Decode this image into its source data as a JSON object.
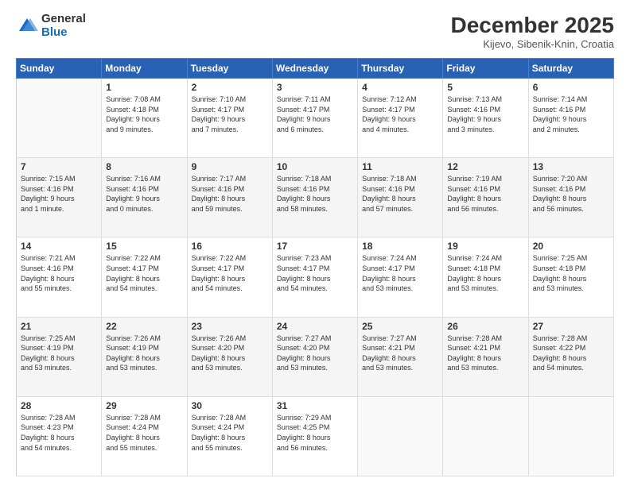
{
  "header": {
    "logo_general": "General",
    "logo_blue": "Blue",
    "month_title": "December 2025",
    "location": "Kijevo, Sibenik-Knin, Croatia"
  },
  "days_of_week": [
    "Sunday",
    "Monday",
    "Tuesday",
    "Wednesday",
    "Thursday",
    "Friday",
    "Saturday"
  ],
  "weeks": [
    [
      {
        "day": "",
        "info": ""
      },
      {
        "day": "1",
        "info": "Sunrise: 7:08 AM\nSunset: 4:18 PM\nDaylight: 9 hours\nand 9 minutes."
      },
      {
        "day": "2",
        "info": "Sunrise: 7:10 AM\nSunset: 4:17 PM\nDaylight: 9 hours\nand 7 minutes."
      },
      {
        "day": "3",
        "info": "Sunrise: 7:11 AM\nSunset: 4:17 PM\nDaylight: 9 hours\nand 6 minutes."
      },
      {
        "day": "4",
        "info": "Sunrise: 7:12 AM\nSunset: 4:17 PM\nDaylight: 9 hours\nand 4 minutes."
      },
      {
        "day": "5",
        "info": "Sunrise: 7:13 AM\nSunset: 4:16 PM\nDaylight: 9 hours\nand 3 minutes."
      },
      {
        "day": "6",
        "info": "Sunrise: 7:14 AM\nSunset: 4:16 PM\nDaylight: 9 hours\nand 2 minutes."
      }
    ],
    [
      {
        "day": "7",
        "info": "Sunrise: 7:15 AM\nSunset: 4:16 PM\nDaylight: 9 hours\nand 1 minute."
      },
      {
        "day": "8",
        "info": "Sunrise: 7:16 AM\nSunset: 4:16 PM\nDaylight: 9 hours\nand 0 minutes."
      },
      {
        "day": "9",
        "info": "Sunrise: 7:17 AM\nSunset: 4:16 PM\nDaylight: 8 hours\nand 59 minutes."
      },
      {
        "day": "10",
        "info": "Sunrise: 7:18 AM\nSunset: 4:16 PM\nDaylight: 8 hours\nand 58 minutes."
      },
      {
        "day": "11",
        "info": "Sunrise: 7:18 AM\nSunset: 4:16 PM\nDaylight: 8 hours\nand 57 minutes."
      },
      {
        "day": "12",
        "info": "Sunrise: 7:19 AM\nSunset: 4:16 PM\nDaylight: 8 hours\nand 56 minutes."
      },
      {
        "day": "13",
        "info": "Sunrise: 7:20 AM\nSunset: 4:16 PM\nDaylight: 8 hours\nand 56 minutes."
      }
    ],
    [
      {
        "day": "14",
        "info": "Sunrise: 7:21 AM\nSunset: 4:16 PM\nDaylight: 8 hours\nand 55 minutes."
      },
      {
        "day": "15",
        "info": "Sunrise: 7:22 AM\nSunset: 4:17 PM\nDaylight: 8 hours\nand 54 minutes."
      },
      {
        "day": "16",
        "info": "Sunrise: 7:22 AM\nSunset: 4:17 PM\nDaylight: 8 hours\nand 54 minutes."
      },
      {
        "day": "17",
        "info": "Sunrise: 7:23 AM\nSunset: 4:17 PM\nDaylight: 8 hours\nand 54 minutes."
      },
      {
        "day": "18",
        "info": "Sunrise: 7:24 AM\nSunset: 4:17 PM\nDaylight: 8 hours\nand 53 minutes."
      },
      {
        "day": "19",
        "info": "Sunrise: 7:24 AM\nSunset: 4:18 PM\nDaylight: 8 hours\nand 53 minutes."
      },
      {
        "day": "20",
        "info": "Sunrise: 7:25 AM\nSunset: 4:18 PM\nDaylight: 8 hours\nand 53 minutes."
      }
    ],
    [
      {
        "day": "21",
        "info": "Sunrise: 7:25 AM\nSunset: 4:19 PM\nDaylight: 8 hours\nand 53 minutes."
      },
      {
        "day": "22",
        "info": "Sunrise: 7:26 AM\nSunset: 4:19 PM\nDaylight: 8 hours\nand 53 minutes."
      },
      {
        "day": "23",
        "info": "Sunrise: 7:26 AM\nSunset: 4:20 PM\nDaylight: 8 hours\nand 53 minutes."
      },
      {
        "day": "24",
        "info": "Sunrise: 7:27 AM\nSunset: 4:20 PM\nDaylight: 8 hours\nand 53 minutes."
      },
      {
        "day": "25",
        "info": "Sunrise: 7:27 AM\nSunset: 4:21 PM\nDaylight: 8 hours\nand 53 minutes."
      },
      {
        "day": "26",
        "info": "Sunrise: 7:28 AM\nSunset: 4:21 PM\nDaylight: 8 hours\nand 53 minutes."
      },
      {
        "day": "27",
        "info": "Sunrise: 7:28 AM\nSunset: 4:22 PM\nDaylight: 8 hours\nand 54 minutes."
      }
    ],
    [
      {
        "day": "28",
        "info": "Sunrise: 7:28 AM\nSunset: 4:23 PM\nDaylight: 8 hours\nand 54 minutes."
      },
      {
        "day": "29",
        "info": "Sunrise: 7:28 AM\nSunset: 4:24 PM\nDaylight: 8 hours\nand 55 minutes."
      },
      {
        "day": "30",
        "info": "Sunrise: 7:28 AM\nSunset: 4:24 PM\nDaylight: 8 hours\nand 55 minutes."
      },
      {
        "day": "31",
        "info": "Sunrise: 7:29 AM\nSunset: 4:25 PM\nDaylight: 8 hours\nand 56 minutes."
      },
      {
        "day": "",
        "info": ""
      },
      {
        "day": "",
        "info": ""
      },
      {
        "day": "",
        "info": ""
      }
    ]
  ]
}
